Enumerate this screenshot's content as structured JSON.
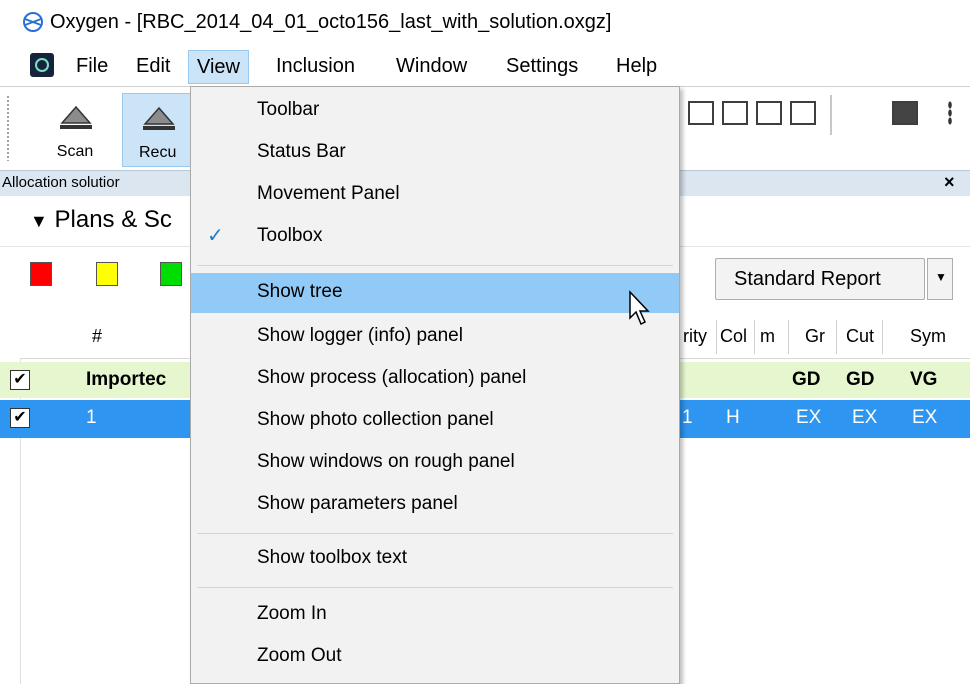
{
  "window": {
    "title": "Oxygen - [RBC_2014_04_01_octo156_last_with_solution.oxgz]"
  },
  "menu": {
    "items": [
      "File",
      "Edit",
      "View",
      "Inclusion",
      "Window",
      "Settings",
      "Help"
    ],
    "open": "View"
  },
  "toolbar": {
    "scan_label": "Scan",
    "recut_label": "Recu"
  },
  "panel": {
    "title": "Allocation solutior",
    "close_glyph": "×",
    "section_title": "Plans & Sc",
    "report_button": "Standard Report"
  },
  "swatches": [
    "#ff0000",
    "#ffff00",
    "#00dd00"
  ],
  "grid": {
    "headers": {
      "num": "#",
      "clarity": "rity",
      "col": "Col",
      "m": "m",
      "gr": "Gr",
      "cut": "Cut",
      "sym": "Sym"
    },
    "rows": [
      {
        "name": "Importec",
        "check": "✔",
        "gr": "GD",
        "cut": "GD",
        "sym": "VG"
      },
      {
        "num": "1",
        "check": "✔",
        "clarity": "1",
        "col": "H",
        "gr": "EX",
        "cut": "EX",
        "sym": "EX"
      }
    ]
  },
  "view_menu": {
    "items": [
      {
        "label": "Toolbar",
        "checked": false
      },
      {
        "label": "Status Bar",
        "checked": false
      },
      {
        "label": "Movement Panel",
        "checked": false
      },
      {
        "label": "Toolbox",
        "checked": true
      },
      {
        "label": "Show tree",
        "highlighted": true
      },
      {
        "label": "Show logger (info) panel"
      },
      {
        "label": "Show process (allocation) panel"
      },
      {
        "label": "Show photo collection panel"
      },
      {
        "label": "Show windows on rough panel"
      },
      {
        "label": "Show parameters panel"
      },
      {
        "label": "Show toolbox text"
      },
      {
        "label": "Zoom In"
      },
      {
        "label": "Zoom Out"
      }
    ],
    "check_glyph": "✓"
  }
}
